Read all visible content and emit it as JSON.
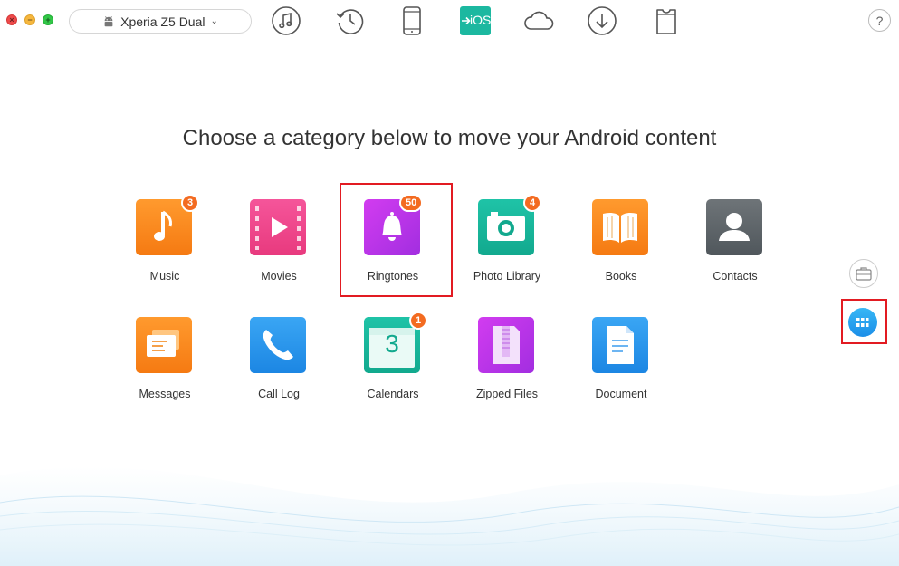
{
  "window": {
    "controls": {
      "close": "×",
      "minimize": "−",
      "maximize": "+"
    }
  },
  "device_selector": {
    "icon": "android-icon",
    "device_name": "Xperia Z5 Dual",
    "chevron": "⌄"
  },
  "toolbar": {
    "icons": [
      "music-library-icon",
      "history-icon",
      "phone-icon",
      "to-ios-icon",
      "cloud-icon",
      "download-icon",
      "tshirt-icon"
    ],
    "ios_label": "iOS",
    "help_label": "?"
  },
  "headline": "Choose a category below to move your Android content",
  "categories": [
    {
      "label": "Music",
      "badge": "3"
    },
    {
      "label": "Movies",
      "badge": ""
    },
    {
      "label": "Ringtones",
      "badge": "50"
    },
    {
      "label": "Photo Library",
      "badge": "4"
    },
    {
      "label": "Books",
      "badge": ""
    },
    {
      "label": "Contacts",
      "badge": ""
    },
    {
      "label": "Messages",
      "badge": ""
    },
    {
      "label": "Call Log",
      "badge": ""
    },
    {
      "label": "Calendars",
      "badge": "1",
      "icon_text": "3"
    },
    {
      "label": "Zipped Files",
      "badge": ""
    },
    {
      "label": "Document",
      "badge": ""
    }
  ],
  "side_buttons": [
    "toolbox-icon",
    "apps-grid-icon"
  ],
  "colors": {
    "highlight": "#e21b22",
    "badge": "#f36b21",
    "accent_blue": "#1c8ee8",
    "ios_green": "#1cb8a0"
  }
}
